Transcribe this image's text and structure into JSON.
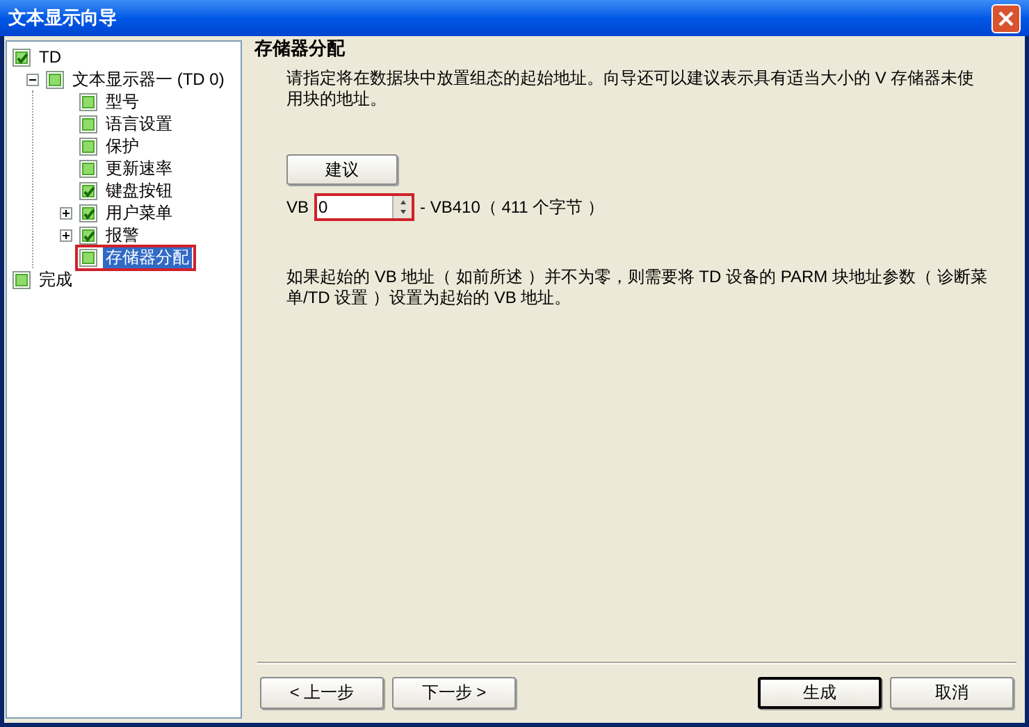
{
  "window": {
    "title": "文本显示向导"
  },
  "tree": [
    {
      "label": "TD",
      "checked": true,
      "selected": false,
      "marked": false,
      "children": [
        {
          "label": "文本显示器一 (TD 0)",
          "checked": false,
          "selected": false,
          "marked": false,
          "expanded": true,
          "children": [
            {
              "label": "型号",
              "checked": false,
              "selected": false,
              "marked": false
            },
            {
              "label": "语言设置",
              "checked": false,
              "selected": false,
              "marked": false
            },
            {
              "label": "保护",
              "checked": false,
              "selected": false,
              "marked": false
            },
            {
              "label": "更新速率",
              "checked": false,
              "selected": false,
              "marked": false
            },
            {
              "label": "键盘按钮",
              "checked": true,
              "selected": false,
              "marked": false
            },
            {
              "label": "用户菜单",
              "checked": true,
              "selected": false,
              "marked": false,
              "expanded": false
            },
            {
              "label": "报警",
              "checked": true,
              "selected": false,
              "marked": false,
              "expanded": false
            },
            {
              "label": "存储器分配",
              "checked": false,
              "selected": true,
              "marked": true
            }
          ]
        }
      ]
    },
    {
      "label": "完成",
      "checked": false,
      "selected": false,
      "marked": false
    }
  ],
  "page": {
    "heading": "存储器分配",
    "intro": "请指定将在数据块中放置组态的起始地址。向导还可以建议表示具有适当大小的 V 存储器未使用块的地址。",
    "suggest_button": "建议",
    "address": {
      "prefix": "VB",
      "value": "0",
      "marked": true,
      "range": "- VB410（ 411 个字节 ）"
    },
    "note": "如果起始的 VB 地址（ 如前所述 ）并不为零，则需要将 TD 设备的 PARM 块地址参数（ 诊断菜单/TD 设置 ）设置为起始的 VB 地址。"
  },
  "buttons": [
    {
      "label": "< 上一步",
      "default": false
    },
    {
      "label": "下一步 >",
      "default": false
    },
    {
      "label": "生成",
      "default": true
    },
    {
      "label": "取消",
      "default": false
    }
  ]
}
